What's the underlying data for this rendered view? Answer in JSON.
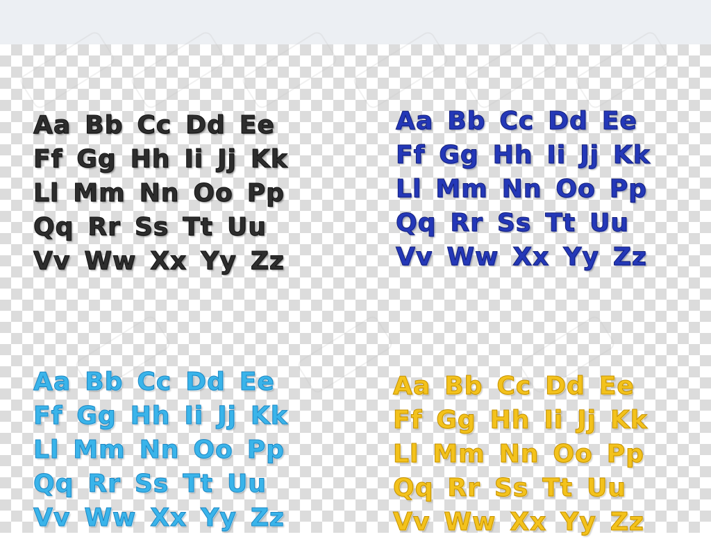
{
  "colors": {
    "black_set": "#2d2d2d",
    "blue_set": "#2438b8",
    "cyan_set": "#3ab4ea",
    "gold_set": "#f3c21c",
    "top_bar": "#eceff3"
  },
  "alphabet_sets": {
    "black": {
      "rows": [
        [
          "Aa",
          "Bb",
          "Cc",
          "Dd",
          "Ee"
        ],
        [
          "Ff",
          "Gg",
          "Hh",
          "Ii",
          "Jj",
          "Kk"
        ],
        [
          "Ll",
          "Mm",
          "Nn",
          "Oo",
          "Pp"
        ],
        [
          "Qq",
          "Rr",
          "Ss",
          "Tt",
          "Uu"
        ],
        [
          "Vv",
          "Ww",
          "Xx",
          "Yy",
          "Zz"
        ]
      ]
    },
    "blue": {
      "rows": [
        [
          "Aa",
          "Bb",
          "Cc",
          "Dd",
          "Ee"
        ],
        [
          "Ff",
          "Gg",
          "Hh",
          "Ii",
          "Jj",
          "Kk"
        ],
        [
          "Ll",
          "Mm",
          "Nn",
          "Oo",
          "Pp"
        ],
        [
          "Qq",
          "Rr",
          "Ss",
          "Tt",
          "Uu"
        ],
        [
          "Vv",
          "Ww",
          "Xx",
          "Yy",
          "Zz"
        ]
      ]
    },
    "cyan": {
      "rows": [
        [
          "Aa",
          "Bb",
          "Cc",
          "Dd",
          "Ee"
        ],
        [
          "Ff",
          "Gg",
          "Hh",
          "Ii",
          "Jj",
          "Kk"
        ],
        [
          "Ll",
          "Mm",
          "Nn",
          "Oo",
          "Pp"
        ],
        [
          "Qq",
          "Rr",
          "Ss",
          "Tt",
          "Uu"
        ],
        [
          "Vv",
          "Ww",
          "Xx",
          "Yy",
          "Zz"
        ]
      ]
    },
    "gold": {
      "rows": [
        [
          "Aa",
          "Bb",
          "Cc",
          "Dd",
          "Ee"
        ],
        [
          "Ff",
          "Gg",
          "Hh",
          "Ii",
          "Jj",
          "Kk"
        ],
        [
          "Ll",
          "Mm",
          "Nn",
          "Oo",
          "Pp"
        ],
        [
          "Qq",
          "Rr",
          "Ss",
          "Tt",
          "Uu"
        ],
        [
          "Vv",
          "Ww",
          "Xx",
          "Yy",
          "Zz"
        ]
      ]
    }
  }
}
